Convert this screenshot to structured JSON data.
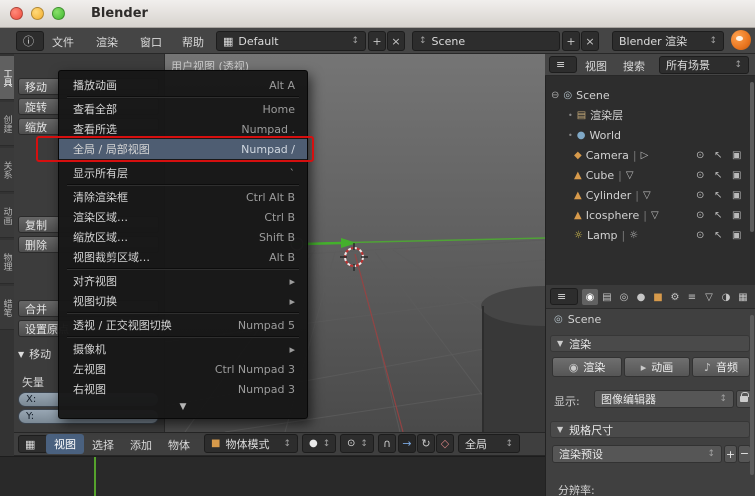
{
  "colors": {
    "annotation_red": "#d60f0f",
    "menu_highlight": "#4e5d72",
    "active_blue": "#4a617f",
    "axis_green": "#4fa336",
    "axis_red": "#9a4242",
    "frame_green": "#55a22c",
    "object_orange": "#d79a4b"
  },
  "icons": {
    "updown": "↕",
    "plus": "+",
    "close": "×",
    "submenu_arrow": "▸",
    "more_down": "▼",
    "panel_down": "▼",
    "info": "ⓘ",
    "grid": "▦",
    "menu_lines": "≡",
    "eye": "⊙",
    "cursor_select": "↖",
    "render_restrict": "▣",
    "expander_open": "⊖",
    "dot": "•",
    "divider": "|",
    "scene": "◎",
    "renderlayer": "▤",
    "world": "●",
    "camera_obj": "◆",
    "mesh_obj": "▲",
    "lamp_obj": "☼",
    "camera_data": "▷",
    "mesh_data": "▽",
    "lamp_data": "☼",
    "tab_render": "◉",
    "tab_render_layers": "▤",
    "tab_scene": "◎",
    "tab_world": "●",
    "tab_object": "■",
    "tab_constraints": "⚙",
    "tab_modifiers": "≡",
    "tab_data": "▽",
    "tab_material": "◑",
    "tab_texture": "▦",
    "render_still": "◉",
    "render_anim": "▸",
    "audio": "♪",
    "object_mode_cube": "■",
    "shading_sphere": "●",
    "pivot": "⊙",
    "snap_magnet": "∩",
    "manip_translate": "→",
    "manip_rotate": "↻",
    "manip_scale": "◇"
  },
  "titlebar": {
    "title": "Blender"
  },
  "info_header": {
    "menus": [
      {
        "label": "文件"
      },
      {
        "label": "渲染"
      },
      {
        "label": "窗口"
      },
      {
        "label": "帮助"
      }
    ],
    "layout": {
      "value": "Default"
    },
    "scene": {
      "value": "Scene"
    },
    "engine": {
      "value": "Blender 渲染"
    }
  },
  "viewport": {
    "label": "用户视图 (透视)"
  },
  "view_menu": {
    "items": [
      {
        "label": "播放动画",
        "shortcut": "Alt A"
      },
      {
        "label": "查看全部",
        "shortcut": "Home"
      },
      {
        "label": "查看所选",
        "shortcut": "Numpad ."
      },
      {
        "label": "全局 / 局部视图",
        "shortcut": "Numpad /"
      },
      {
        "label": "显示所有层",
        "shortcut": "`"
      },
      {
        "label": "清除渲染框",
        "shortcut": "Ctrl Alt B"
      },
      {
        "label": "渲染区域…",
        "shortcut": "Ctrl B"
      },
      {
        "label": "缩放区域…",
        "shortcut": "Shift B"
      },
      {
        "label": "视图裁剪区域…",
        "shortcut": "Alt B"
      },
      {
        "label": "对齐视图"
      },
      {
        "label": "视图切换"
      },
      {
        "label": "透视 / 正交视图切换",
        "shortcut": "Numpad 5"
      },
      {
        "label": "摄像机"
      },
      {
        "label": "左视图",
        "shortcut": "Ctrl Numpad 3"
      },
      {
        "label": "右视图",
        "shortcut": "Numpad 3"
      }
    ]
  },
  "tool_tabs": [
    {
      "label": "工具"
    },
    {
      "label": "创建"
    },
    {
      "label": "关系"
    },
    {
      "label": "动画"
    },
    {
      "label": "物理"
    },
    {
      "label": "蜡笔"
    }
  ],
  "tool_shelf": {
    "buttons": [
      {
        "label": "移动"
      },
      {
        "label": "旋转"
      },
      {
        "label": "缩放"
      },
      {
        "label": "复制"
      },
      {
        "label": "删除"
      },
      {
        "label": "合并"
      },
      {
        "label": "设置原点"
      }
    ],
    "operator_panel": {
      "title": "移动",
      "vector_label": "矢量",
      "fields": [
        {
          "label": "X:"
        },
        {
          "label": "Y:"
        }
      ]
    }
  },
  "outliner": {
    "header": {
      "view_menu": "视图",
      "search_menu": "搜索",
      "scope": "所有场景"
    },
    "rows": [
      {
        "name": "Scene"
      },
      {
        "name": "渲染层"
      },
      {
        "name": "World"
      },
      {
        "name": "Camera"
      },
      {
        "name": "Cube"
      },
      {
        "name": "Cylinder"
      },
      {
        "name": "Icosphere"
      },
      {
        "name": "Lamp"
      }
    ]
  },
  "properties": {
    "breadcrumb": {
      "context": "Scene"
    },
    "render_panel": {
      "title": "渲染",
      "render_button": "渲染",
      "animation_button": "动画",
      "audio_button": "音频",
      "display_label": "显示:",
      "display_value": "图像编辑器"
    },
    "dimensions_panel": {
      "title": "规格尺寸",
      "preset": "渲染预设",
      "resolution_label": "分辨率:"
    }
  },
  "view3d_header": {
    "menus": [
      {
        "label": "视图"
      },
      {
        "label": "选择"
      },
      {
        "label": "添加"
      },
      {
        "label": "物体"
      }
    ],
    "mode": "物体模式",
    "orientation": "全局"
  }
}
